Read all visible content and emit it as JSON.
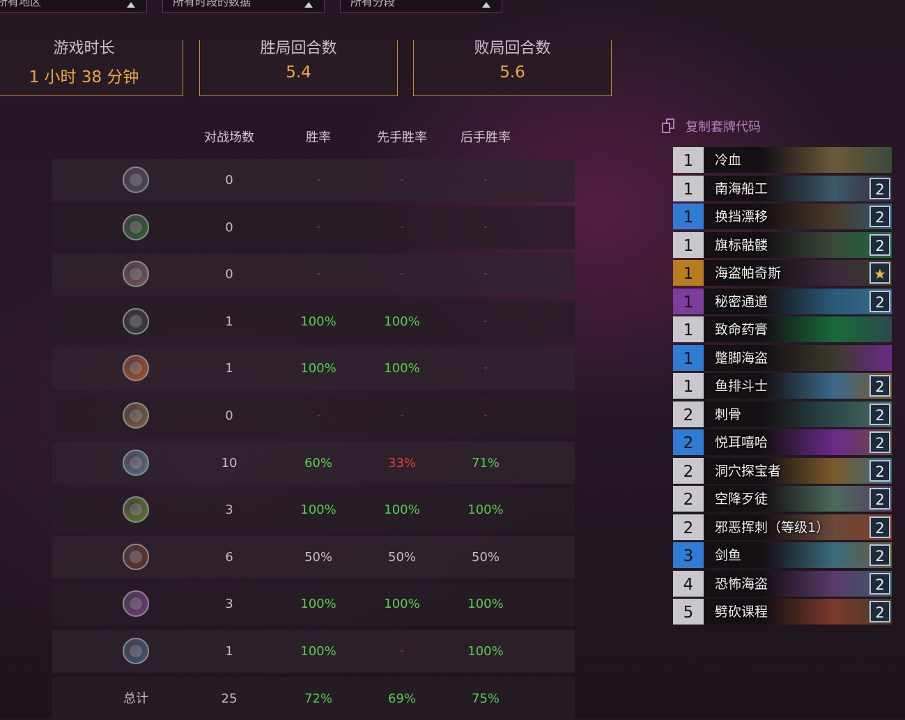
{
  "filters": [
    {
      "label": "所有地区"
    },
    {
      "label": "所有时段的数据"
    },
    {
      "label": "所有分段"
    }
  ],
  "stats": [
    {
      "label": "游戏时长",
      "value": "1 小时 38 分钟"
    },
    {
      "label": "胜局回合数",
      "value": "5.4"
    },
    {
      "label": "败局回合数",
      "value": "5.6"
    }
  ],
  "table": {
    "headers": {
      "games": "对战场数",
      "winrate": "胜率",
      "first": "先手胜率",
      "second": "后手胜率"
    },
    "rows": [
      {
        "icon": "rogue-class-icon",
        "games": "0",
        "wr": "-",
        "first": "-",
        "second": "-"
      },
      {
        "icon": "shaman-class-icon",
        "games": "0",
        "wr": "-",
        "first": "-",
        "second": "-"
      },
      {
        "icon": "druid-class-icon",
        "games": "0",
        "wr": "-",
        "first": "-",
        "second": "-"
      },
      {
        "icon": "hunter-class-icon",
        "games": "1",
        "wr": "100%",
        "first": "100%",
        "second": "-"
      },
      {
        "icon": "mage-class-icon",
        "games": "1",
        "wr": "100%",
        "first": "100%",
        "second": "-"
      },
      {
        "icon": "paladin-class-icon",
        "games": "0",
        "wr": "-",
        "first": "-",
        "second": "-"
      },
      {
        "icon": "priest-class-icon",
        "games": "10",
        "wr": "60%",
        "first": "33%",
        "second": "71%"
      },
      {
        "icon": "demon-hunter-class-icon",
        "games": "3",
        "wr": "100%",
        "first": "100%",
        "second": "100%"
      },
      {
        "icon": "warlock-class-icon",
        "games": "6",
        "wr": "50%",
        "first": "50%",
        "second": "50%"
      },
      {
        "icon": "death-knight-class-icon",
        "games": "3",
        "wr": "100%",
        "first": "100%",
        "second": "100%"
      },
      {
        "icon": "warrior-class-icon",
        "games": "1",
        "wr": "100%",
        "first": "-",
        "second": "100%"
      }
    ],
    "total": {
      "label": "总计",
      "games": "25",
      "wr": "72%",
      "first": "69%",
      "second": "75%"
    },
    "colors": {
      "win": "#55d04a",
      "loss": "#e23d3d",
      "neutral": "#c6bcc4"
    }
  },
  "deck": {
    "copy_label": "复制套牌代码",
    "cards": [
      {
        "cost": "1",
        "name": "冷血",
        "count": "",
        "rarity": "common"
      },
      {
        "cost": "1",
        "name": "南海船工",
        "count": "2",
        "rarity": "common"
      },
      {
        "cost": "1",
        "name": "换挡漂移",
        "count": "2",
        "rarity": "rare"
      },
      {
        "cost": "1",
        "name": "旗标骷髅",
        "count": "2",
        "rarity": "common"
      },
      {
        "cost": "1",
        "name": "海盗帕奇斯",
        "count": "★",
        "rarity": "legendary"
      },
      {
        "cost": "1",
        "name": "秘密通道",
        "count": "2",
        "rarity": "epic"
      },
      {
        "cost": "1",
        "name": "致命药膏",
        "count": "",
        "rarity": "common"
      },
      {
        "cost": "1",
        "name": "蹩脚海盗",
        "count": "",
        "rarity": "rare"
      },
      {
        "cost": "1",
        "name": "鱼排斗士",
        "count": "2",
        "rarity": "common"
      },
      {
        "cost": "2",
        "name": "刺骨",
        "count": "2",
        "rarity": "common"
      },
      {
        "cost": "2",
        "name": "悦耳嘻哈",
        "count": "2",
        "rarity": "rare"
      },
      {
        "cost": "2",
        "name": "洞穴探宝者",
        "count": "2",
        "rarity": "common"
      },
      {
        "cost": "2",
        "name": "空降歹徒",
        "count": "2",
        "rarity": "common"
      },
      {
        "cost": "2",
        "name": "邪恶挥刺（等级1）",
        "count": "2",
        "rarity": "common"
      },
      {
        "cost": "3",
        "name": "剑鱼",
        "count": "2",
        "rarity": "rare"
      },
      {
        "cost": "4",
        "name": "恐怖海盗",
        "count": "2",
        "rarity": "common"
      },
      {
        "cost": "5",
        "name": "劈砍课程",
        "count": "2",
        "rarity": "common"
      }
    ]
  }
}
